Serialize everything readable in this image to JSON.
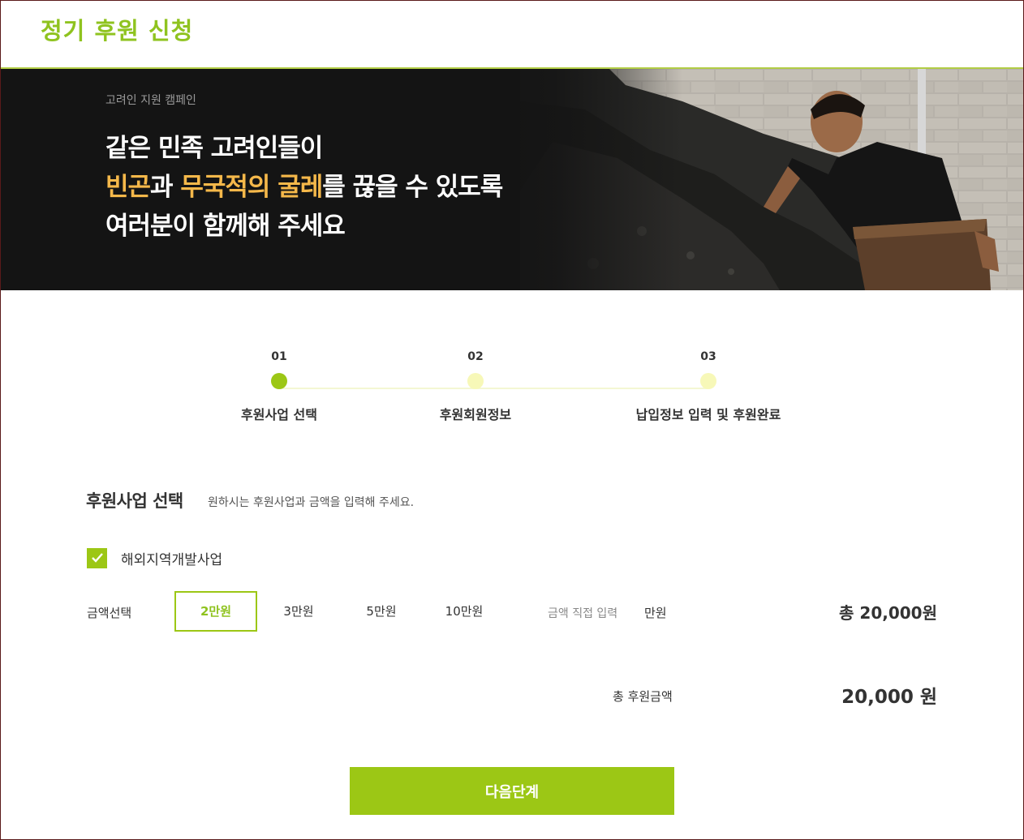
{
  "header": {
    "title": "정기 후원 신청"
  },
  "banner": {
    "tag": "고려인 지원 캠페인",
    "line1": "같은 민족 고려인들이",
    "line2_highlight_a": "빈곤",
    "line2_connector": "과 ",
    "line2_highlight_b": "무국적의 굴레",
    "line2_rest": "를 끊을 수 있도록",
    "line3": "여러분이 함께해 주세요",
    "highlight_color": "#f5b84a",
    "photo_icon": "child-collecting-coal-photo"
  },
  "steps": [
    {
      "num": "01",
      "label": "후원사업 선택",
      "active": true
    },
    {
      "num": "02",
      "label": "후원회원정보",
      "active": false
    },
    {
      "num": "03",
      "label": "납입정보 입력 및 후원완료",
      "active": false
    }
  ],
  "section": {
    "title": "후원사업 선택",
    "desc": "원하시는 후원사업과 금액을 입력해 주세요."
  },
  "project": {
    "label": "해외지역개발사업",
    "checked": true
  },
  "amount": {
    "label": "금액선택",
    "options": [
      "2만원",
      "3만원",
      "5만원",
      "10만원"
    ],
    "selected": "2만원",
    "direct_placeholder": "금액 직접 입력",
    "direct_unit": "만원",
    "line_total": "총 20,000원"
  },
  "total": {
    "label": "총 후원금액",
    "value": "20,000 원"
  },
  "next_button": "다음단계",
  "colors": {
    "accent": "#9cc715",
    "title_green": "#8fc31f",
    "banner_bg": "#141414"
  }
}
